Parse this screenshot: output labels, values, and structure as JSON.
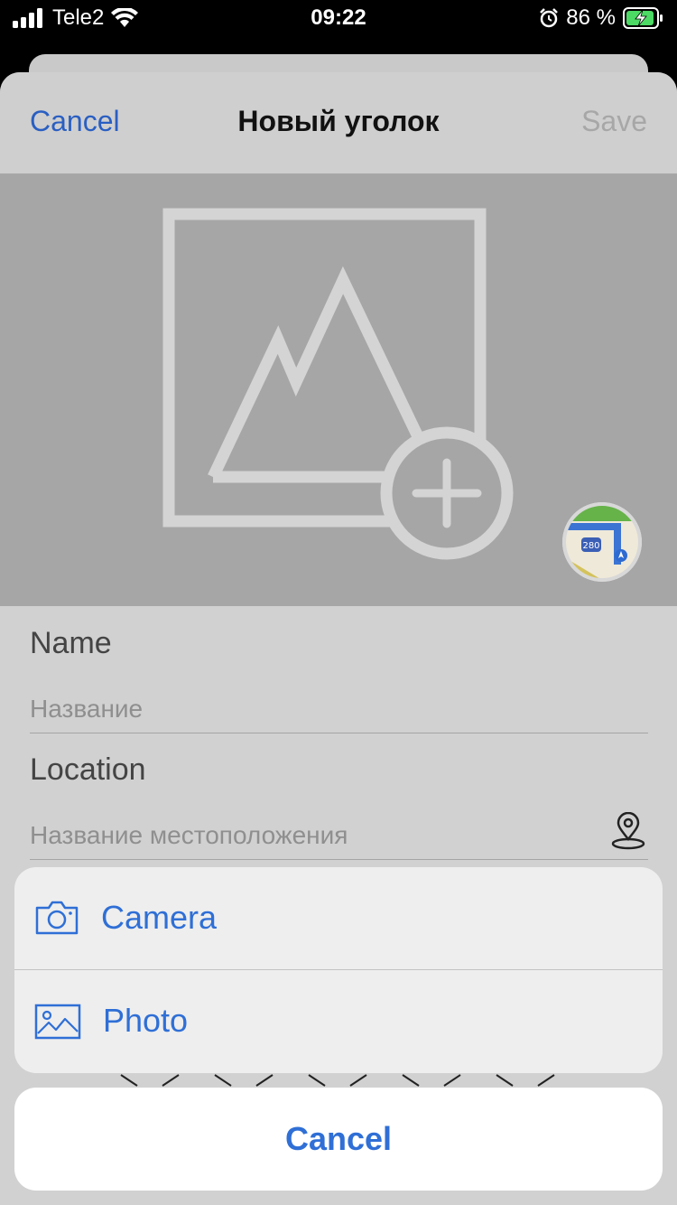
{
  "status_bar": {
    "carrier": "Tele2",
    "time": "09:22",
    "battery_percent": "86 %",
    "icons": [
      "signal-bars-icon",
      "wifi-icon",
      "alarm-icon",
      "battery-charging-icon"
    ]
  },
  "nav": {
    "cancel_label": "Cancel",
    "title": "Новый уголок",
    "save_label": "Save"
  },
  "image_area": {
    "icons": [
      "add-photo-placeholder-icon",
      "maps-app-icon"
    ],
    "map_badge_text": "280"
  },
  "form": {
    "name_label": "Name",
    "name_placeholder": "Название",
    "location_label": "Location",
    "location_placeholder": "Название местоположения",
    "location_icon": "map-pin-icon"
  },
  "action_sheet": {
    "camera_label": "Camera",
    "camera_icon": "camera-icon",
    "photo_label": "Photo",
    "photo_icon": "photo-icon",
    "cancel_label": "Cancel"
  },
  "colors": {
    "accent": "#2f6fd6",
    "nav_accent": "#2a5fc2",
    "disabled": "#a7a7a7",
    "dim_background": "#d1d1d1"
  }
}
